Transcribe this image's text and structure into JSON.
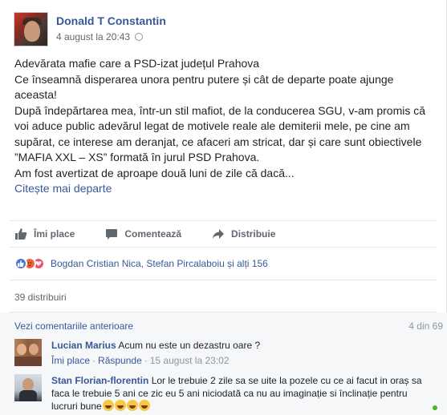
{
  "post": {
    "author": "Donald T Constantin",
    "timestamp": "4 august la 20:43",
    "privacy_icon": "globe-icon",
    "lines": [
      "Adevărata mafie care a PSD-izat județul Prahova",
      "Ce înseamnă disperarea unora pentru putere și cât de departe poate ajunge aceasta!",
      "După îndepărtarea mea, într-un stil mafiot, de la conducerea SGU, v-am promis că voi aduce public adevărul legat de motivele reale ale demiterii mele, pe cine am supărat, ce interese am deranjat, ce afaceri am stricat, dar și care sunt obiectivele ”MAFIA XXL – XS” formată în jurul PSD Prahova.",
      "Am fost avertizat de aproape două luni de zile că dacă..."
    ],
    "see_more": "Citește mai departe"
  },
  "actions": {
    "like": "Îmi place",
    "comment": "Comentează",
    "share": "Distribuie"
  },
  "reactions": {
    "names": "Bogdan Cristian Nica, Stefan Pircalaboiu și alți 156",
    "types": [
      "like",
      "angry",
      "love"
    ]
  },
  "shares": "39 distribuiri",
  "comments": {
    "view_previous": "Vezi comentariile anterioare",
    "count": "4 din 69",
    "items": [
      {
        "name": "Lucian Marius",
        "text": "Acum nu este un dezastru oare ?",
        "like": "Îmi place",
        "reply": "Răspunde",
        "time": "15 august la 23:02"
      },
      {
        "name": "Stan Florian-florentin",
        "text": "Lor le trebuie 2 zile sa se uite la pozele cu ce ai facut in oraș sa faca le trebuie 5 ani ce zic eu 5 ani niciodată ca nu au imaginație si înclinație pentru lucruri bune",
        "emoji": "laughing-emoji"
      }
    ]
  },
  "colors": {
    "link": "#385898",
    "text": "#1d2129",
    "muted": "#616770",
    "online": "#42b72a"
  }
}
